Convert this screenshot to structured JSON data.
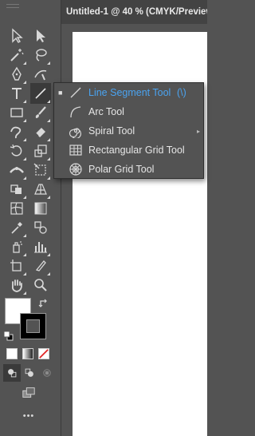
{
  "window": {
    "doc_title": "Untitled-1 @ 40 % (CMYK/Preview"
  },
  "flyout": {
    "items": [
      {
        "label": "Line Segment Tool",
        "shortcut": "(\\)",
        "mark": "■"
      },
      {
        "label": "Arc Tool"
      },
      {
        "label": "Spiral Tool",
        "submenu": "▸"
      },
      {
        "label": "Rectangular Grid Tool"
      },
      {
        "label": "Polar Grid Tool"
      }
    ]
  },
  "toolbar": {
    "more_label": "•••"
  },
  "colors": {
    "accent": "#4aa3f0",
    "panel": "#535353",
    "artboard": "#ffffff"
  }
}
